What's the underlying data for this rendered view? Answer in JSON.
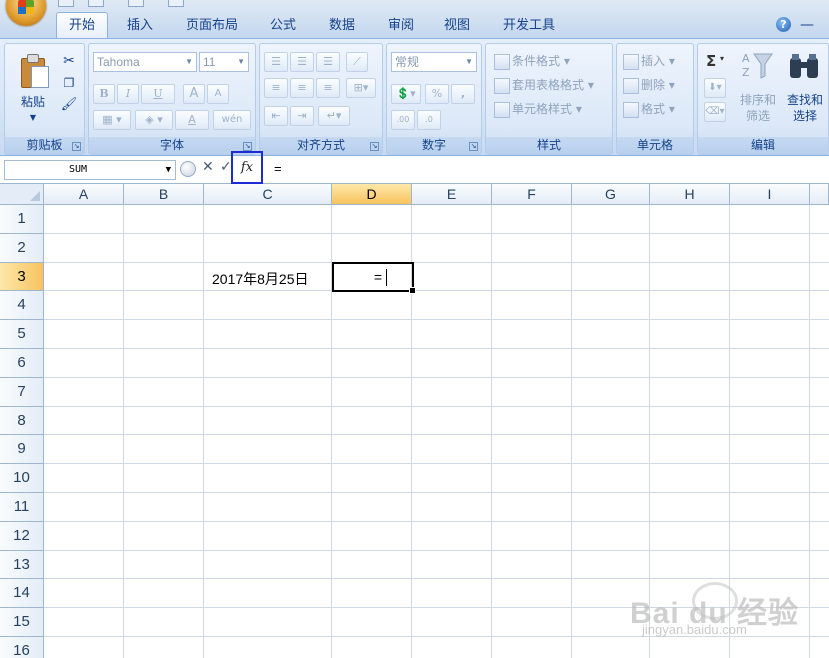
{
  "tabs": [
    "开始",
    "插入",
    "页面布局",
    "公式",
    "数据",
    "审阅",
    "视图",
    "开发工具"
  ],
  "ribbon": {
    "clipboard": {
      "label": "剪贴板",
      "paste": "粘贴"
    },
    "font": {
      "label": "字体",
      "name": "Tahoma",
      "size": "11",
      "bold": "B",
      "italic": "I",
      "underline": "U",
      "grow": "A",
      "shrink": "A",
      "fontcolor": "A",
      "phonetic": "wén"
    },
    "alignment": {
      "label": "对齐方式"
    },
    "number": {
      "label": "数字",
      "format": "常规",
      "percent": "%",
      "comma": ",",
      "inc": ".00",
      "dec": ".0"
    },
    "styles": {
      "label": "样式",
      "conditional": "条件格式",
      "table": "套用表格格式",
      "cell": "单元格样式"
    },
    "cells": {
      "label": "单元格",
      "insert": "插入",
      "delete": "删除",
      "format": "格式"
    },
    "editing": {
      "label": "编辑",
      "sort": "排序和筛选",
      "find": "查找和选择",
      "sum": "Σ"
    }
  },
  "formula_bar": {
    "name_box": "SUM",
    "fx": "fx",
    "content": "="
  },
  "grid": {
    "columns": [
      "A",
      "B",
      "C",
      "D",
      "E",
      "F",
      "G",
      "H",
      "I"
    ],
    "rows": [
      "1",
      "2",
      "3",
      "4",
      "5",
      "6",
      "7",
      "8",
      "9",
      "10",
      "11",
      "12",
      "13",
      "14",
      "15",
      "16"
    ],
    "selected_column": "D",
    "selected_row": "3",
    "cells": {
      "C3": "2017年8月25日",
      "D3": "="
    }
  },
  "watermark": {
    "text": "Bai du 经验",
    "url": "jingyan.baidu.com"
  }
}
